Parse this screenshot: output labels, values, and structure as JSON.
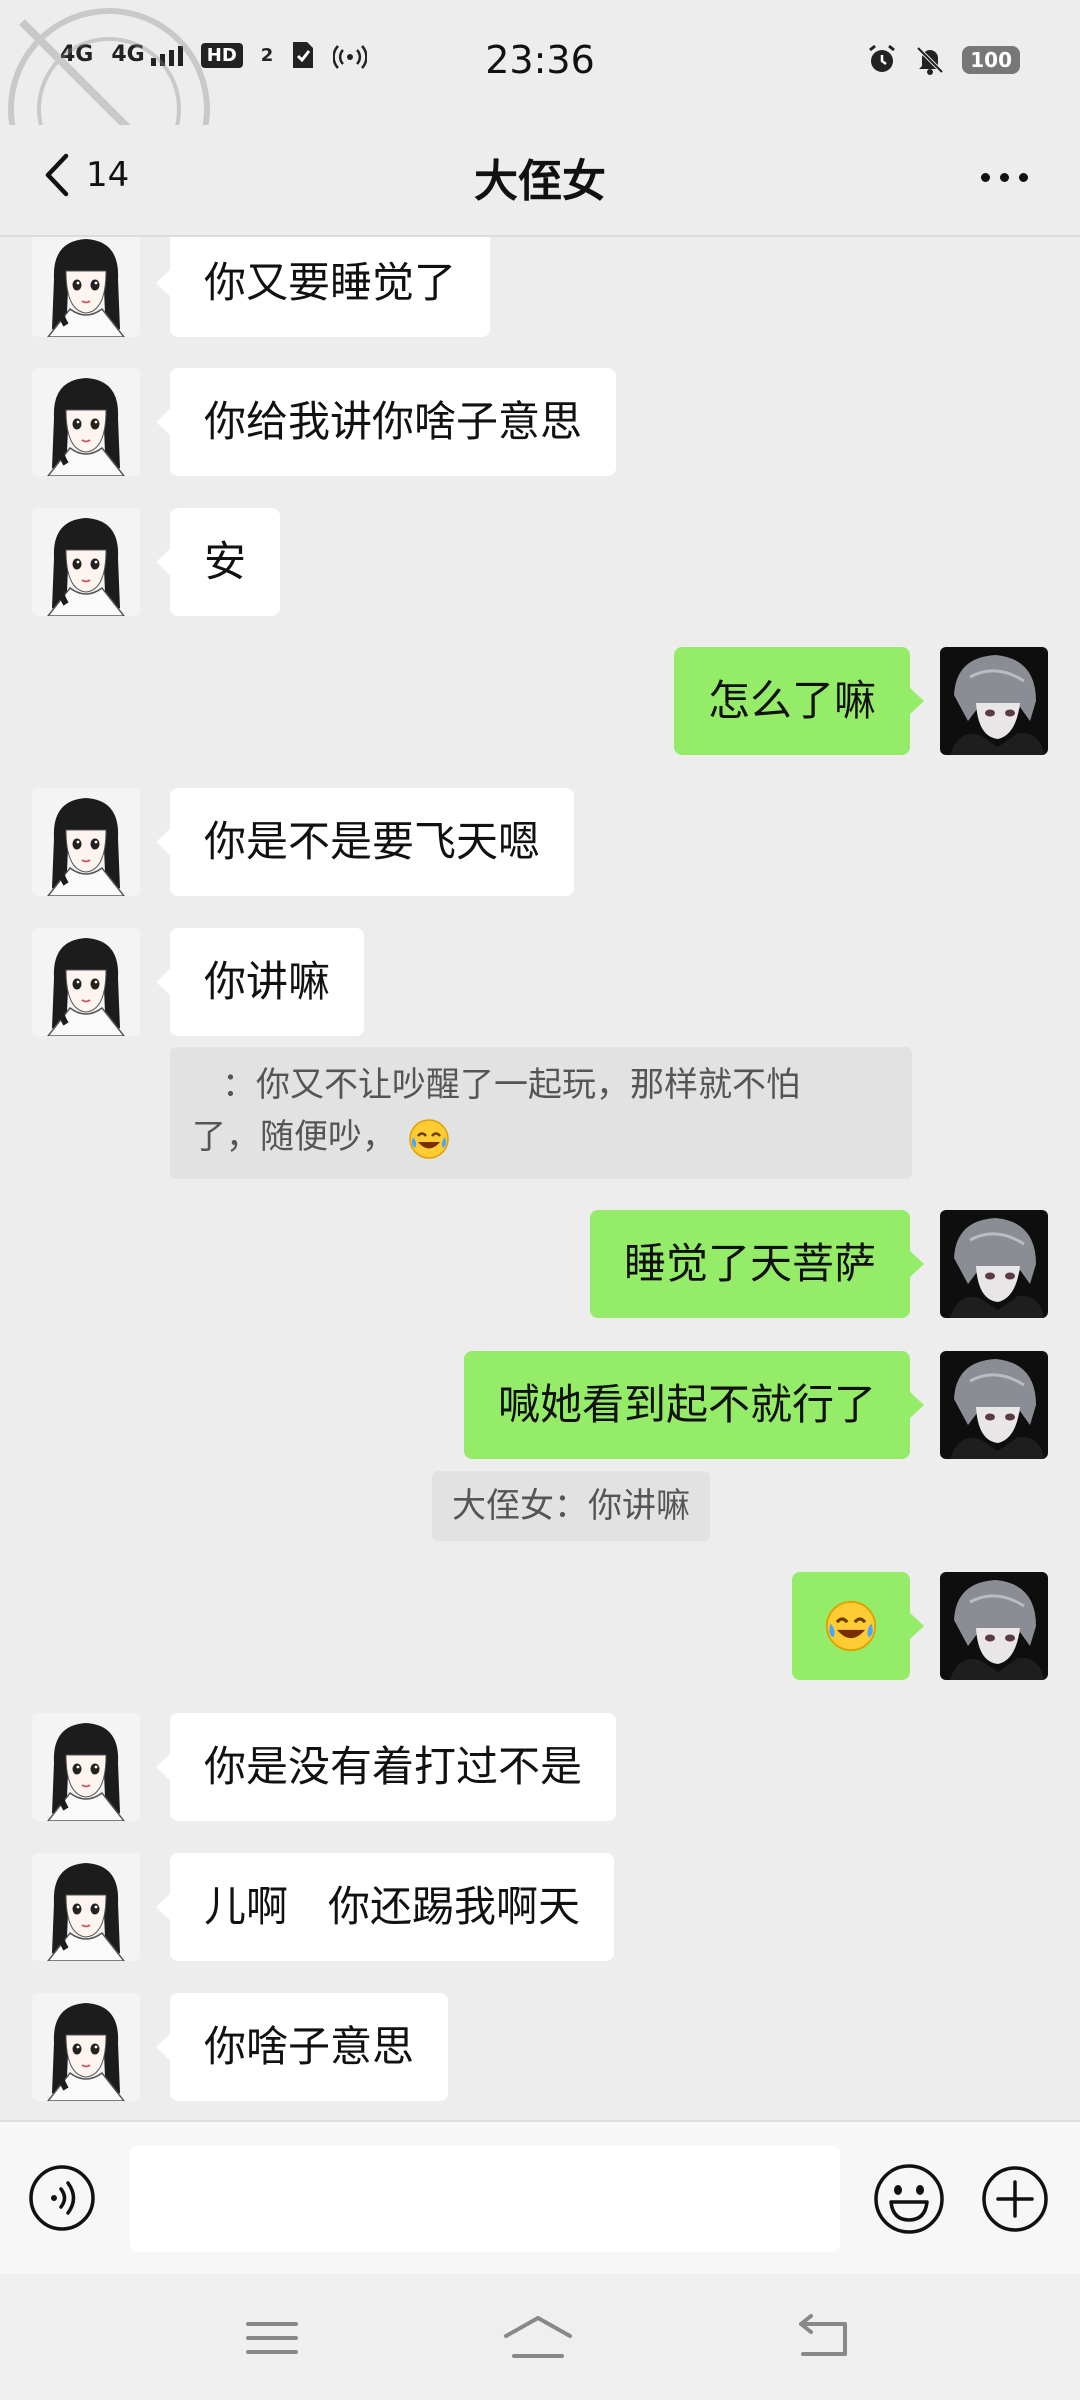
{
  "status_bar": {
    "time": "23:36",
    "network_1": "4G",
    "network_2": "4G",
    "hd": "HD",
    "sim": "2",
    "battery": "100"
  },
  "header": {
    "title": "大侄女",
    "back_count": "14"
  },
  "messages": [
    {
      "side": "left",
      "text": "你又要睡觉了"
    },
    {
      "side": "left",
      "text": "你给我讲你啥子意思"
    },
    {
      "side": "left",
      "text": "安"
    },
    {
      "side": "right",
      "text": "怎么了嘛"
    },
    {
      "side": "left",
      "text": "你是不是要飞天嗯"
    },
    {
      "side": "left",
      "text": "你讲嘛"
    },
    {
      "type": "quote",
      "line1": "：你又不让吵醒了一起玩，那样就不怕",
      "line2": "了，随便吵，"
    },
    {
      "side": "right",
      "text": "睡觉了天菩萨"
    },
    {
      "side": "right",
      "text": "喊她看到起不就行了"
    },
    {
      "type": "quote",
      "text": "大侄女：你讲嘛"
    },
    {
      "side": "right",
      "emoji": "laughing-crying"
    },
    {
      "side": "left",
      "text": "你是没有着打过不是"
    },
    {
      "side": "left",
      "text": "儿啊   你还踢我啊天"
    },
    {
      "side": "left",
      "text": "你啥子意思"
    }
  ],
  "input_bar": {
    "placeholder": ""
  },
  "colors": {
    "background": "#ededed",
    "sent_bubble": "#95ec69",
    "received_bubble": "#ffffff",
    "quote_bg": "#e2e2e2"
  },
  "icons": {
    "voice": "voice-icon",
    "emoji": "emoji-icon",
    "plus": "plus-icon",
    "back": "back-arrow-icon",
    "more": "more-dots-icon"
  }
}
